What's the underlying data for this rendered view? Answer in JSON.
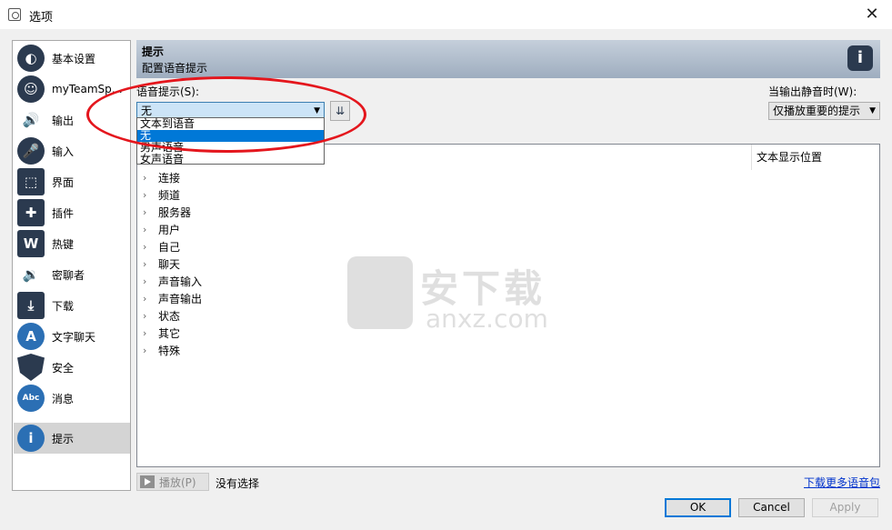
{
  "window": {
    "title": "选项",
    "close_glyph": "✕"
  },
  "sidebar": {
    "items": [
      {
        "label": "基本设置",
        "icon": "settings-icon",
        "selected": false
      },
      {
        "label": "myTeamSpe…",
        "icon": "avatar-icon",
        "selected": false
      },
      {
        "label": "输出",
        "icon": "speaker-icon",
        "selected": false
      },
      {
        "label": "输入",
        "icon": "microphone-icon",
        "selected": false
      },
      {
        "label": "界面",
        "icon": "interface-icon",
        "selected": false
      },
      {
        "label": "插件",
        "icon": "plugin-icon",
        "selected": false
      },
      {
        "label": "热键",
        "icon": "hotkey-icon",
        "selected": false
      },
      {
        "label": "密聊者",
        "icon": "whisper-icon",
        "selected": false
      },
      {
        "label": "下载",
        "icon": "download-icon",
        "selected": false
      },
      {
        "label": "文字聊天",
        "icon": "chat-icon",
        "selected": false
      },
      {
        "label": "安全",
        "icon": "shield-icon",
        "selected": false
      },
      {
        "label": "消息",
        "icon": "message-icon",
        "selected": false
      },
      {
        "label": "提示",
        "icon": "info-icon",
        "selected": true
      }
    ]
  },
  "banner": {
    "title": "提示",
    "subtitle": "配置语音提示",
    "icon": "info-icon",
    "icon_glyph": "i"
  },
  "voice": {
    "label": "语音提示(S):",
    "selected": "无",
    "options": [
      "文本到语音",
      "无",
      "男声语音",
      "女声语音"
    ],
    "highlighted_index": 1
  },
  "mute": {
    "label": "当输出静音时(W):",
    "selected": "仅播放重要的提示"
  },
  "tree": {
    "column_header": "文本显示位置",
    "items": [
      "连接",
      "频道",
      "服务器",
      "用户",
      "自己",
      "聊天",
      "声音输入",
      "声音输出",
      "状态",
      "其它",
      "特殊"
    ]
  },
  "footer": {
    "play_label": "播放(P)",
    "status": "没有选择",
    "more_link": "下载更多语音包"
  },
  "buttons": {
    "ok": "OK",
    "cancel": "Cancel",
    "apply": "Apply"
  },
  "watermark": {
    "title": "安下载",
    "sub": "anxz.com"
  },
  "colors": {
    "highlight": "#0078d7",
    "annotation": "#e4161d",
    "banner": "#9eadbf"
  }
}
